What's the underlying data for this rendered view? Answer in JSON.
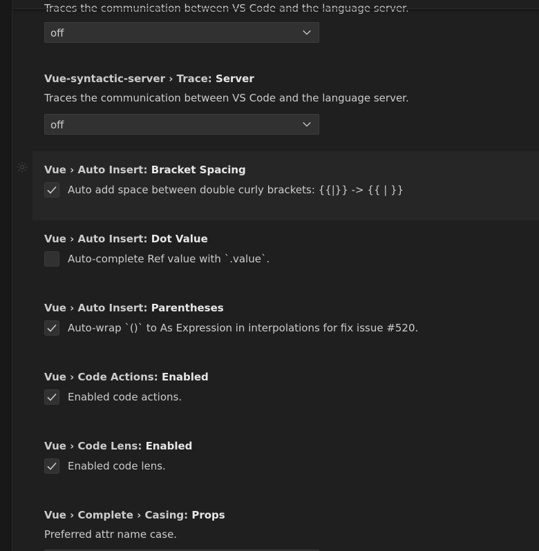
{
  "settings": [
    {
      "id": "vue-server-trace-partial",
      "description": "Traces the communication between VS Code and the language server.",
      "dropdown": "off"
    },
    {
      "id": "vue-syntactic-server-trace",
      "category": "Vue-syntactic-server › Trace: ",
      "name": "Server",
      "description": "Traces the communication between VS Code and the language server.",
      "dropdown": "off"
    },
    {
      "id": "bracket-spacing",
      "category": "Vue › Auto Insert: ",
      "name": "Bracket Spacing",
      "checked": true,
      "checkbox_label": "Auto add space between double curly brackets: {{|}} -> {{ | }}"
    },
    {
      "id": "dot-value",
      "category": "Vue › Auto Insert: ",
      "name": "Dot Value",
      "checked": false,
      "checkbox_label": "Auto-complete Ref value with `.value`."
    },
    {
      "id": "parentheses",
      "category": "Vue › Auto Insert: ",
      "name": "Parentheses",
      "checked": true,
      "checkbox_label": "Auto-wrap `()` to As Expression in interpolations for fix issue #520."
    },
    {
      "id": "code-actions",
      "category": "Vue › Code Actions: ",
      "name": "Enabled",
      "checked": true,
      "checkbox_label": "Enabled code actions."
    },
    {
      "id": "code-lens",
      "category": "Vue › Code Lens: ",
      "name": "Enabled",
      "checked": true,
      "checkbox_label": "Enabled code lens."
    },
    {
      "id": "casing-props",
      "category": "Vue › Complete › Casing: ",
      "name": "Props",
      "description": "Preferred attr name case."
    }
  ],
  "icons": {
    "gear": "gear-icon",
    "chevron": "chevron-down-icon",
    "check": "check-icon"
  },
  "colors": {
    "background": "#1f1f1f",
    "focused_row": "#262626",
    "control_bg": "#313131",
    "control_border": "#3c3c3c",
    "text": "#cccccc"
  }
}
